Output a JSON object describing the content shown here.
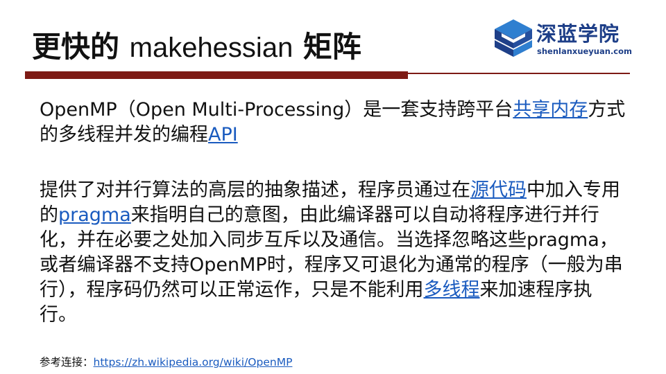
{
  "slide": {
    "title_prefix": "更快的 ",
    "title_code": "makehessian",
    "title_suffix": " 矩阵"
  },
  "logo": {
    "name": "深蓝学院",
    "url": "shenlanxueyuan.com",
    "colors": {
      "dark_blue": "#1e3f88",
      "light_blue": "#2f7fd0"
    }
  },
  "colors": {
    "rule": "#7d1a14",
    "link": "#1a5bbf"
  },
  "paragraph1": {
    "text_a": "OpenMP（Open Multi-Processing）是一套支持跨平台",
    "link_shared_memory": "共享内存",
    "text_b": "方式的多线程并发的编程",
    "link_api": "API"
  },
  "paragraph2": {
    "text_a": "提供了对并行算法的高层的抽象描述，程序员通过在",
    "link_source_code": "源代码",
    "text_b": "中加入专用的",
    "link_pragma": "pragma",
    "text_c": "来指明自己的意图，由此编译器可以自动将程序进行并行化，并在必要之处加入同步互斥以及通信。当选择忽略这些pragma，或者编译器不支持OpenMP时，程序又可退化为通常的程序（一般为串行），程序码仍然可以正常运作，只是不能利用",
    "link_multithreading": "多线程",
    "text_d": "来加速程序执行。"
  },
  "reference": {
    "label": "参考连接：",
    "url": "https://zh.wikipedia.org/wiki/OpenMP"
  }
}
